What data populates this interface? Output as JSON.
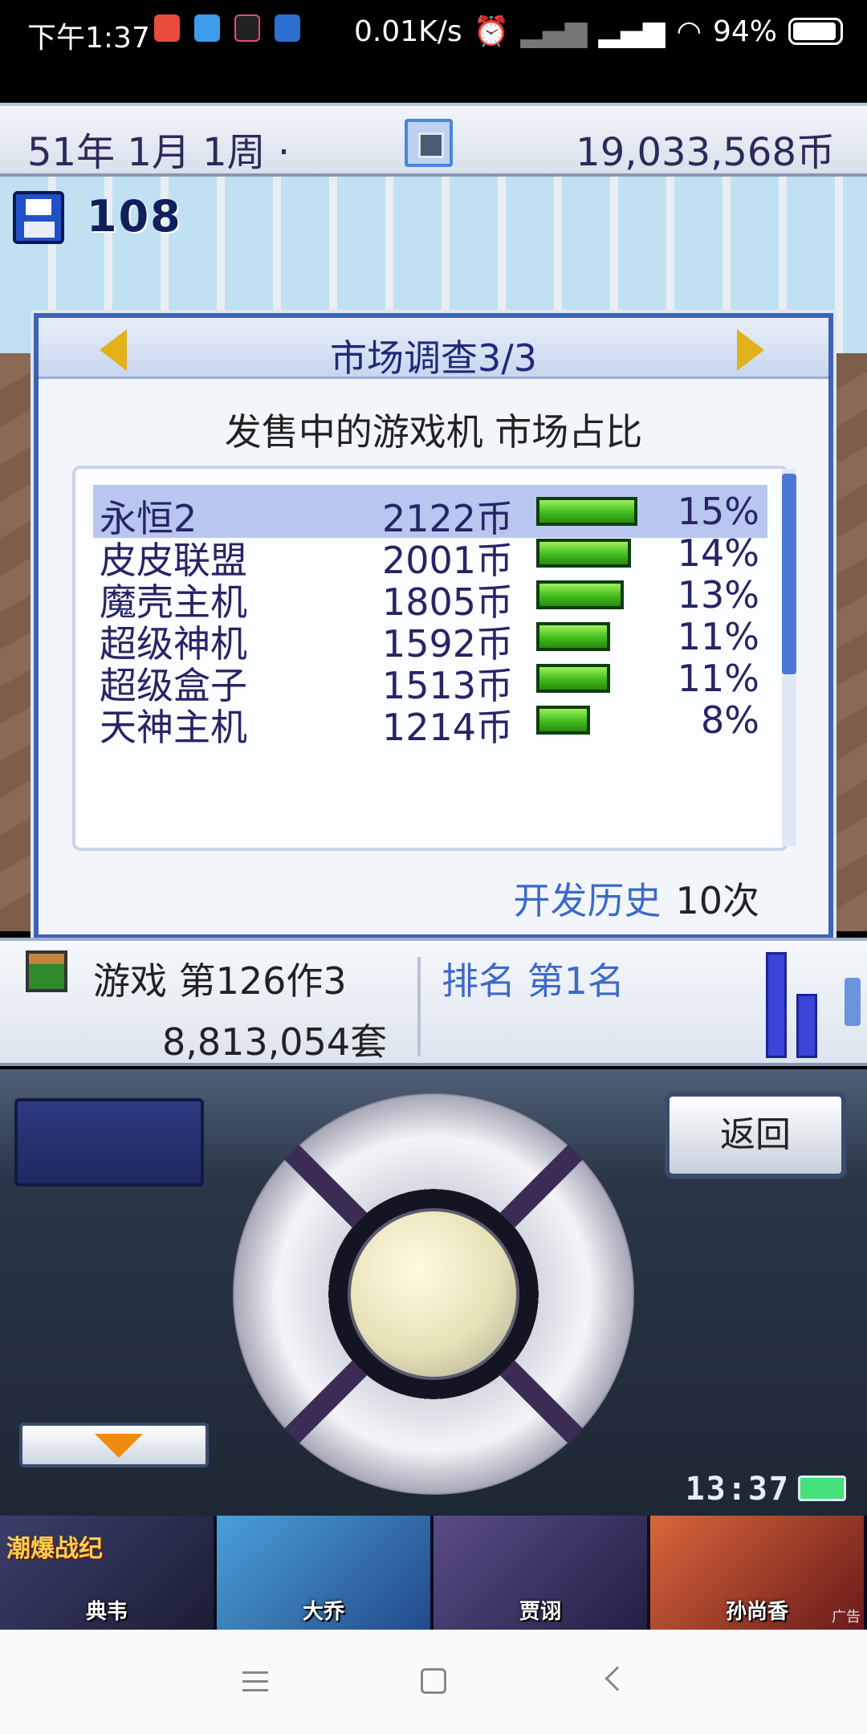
{
  "status_bar": {
    "time": "下午1:37",
    "net_speed": "0.01K/s",
    "battery": "94%",
    "icons": [
      "app-icon",
      "qq-icon",
      "tiktok-icon",
      "app-icon",
      "alarm-icon",
      "signal-icon",
      "hd-signal-icon",
      "wifi-icon",
      "battery-icon"
    ]
  },
  "topbar": {
    "date": "51年 1月 1周 ·",
    "money": "19,033,568币"
  },
  "save": {
    "count": "108"
  },
  "dialog": {
    "title": "市场调查3/3",
    "subtitle": "发售中的游戏机 市场占比",
    "rows": [
      {
        "name": "永恒2",
        "price": "2122币",
        "percent": "15%",
        "share": 15
      },
      {
        "name": "皮皮联盟",
        "price": "2001币",
        "percent": "14%",
        "share": 14
      },
      {
        "name": "魔壳主机",
        "price": "1805币",
        "percent": "13%",
        "share": 13
      },
      {
        "name": "超级神机",
        "price": "1592币",
        "percent": "11%",
        "share": 11
      },
      {
        "name": "超级盒子",
        "price": "1513币",
        "percent": "11%",
        "share": 11
      },
      {
        "name": "天神主机",
        "price": "1214币",
        "percent": "8%",
        "share": 8
      }
    ],
    "history_label": "开发历史",
    "history_value": "10次"
  },
  "info": {
    "title": "游戏 第126作3",
    "sales": "8,813,054套",
    "rank": "排名 第1名"
  },
  "controls": {
    "back_label": "返回",
    "clock": "13:37"
  },
  "ad": {
    "brand": "潮爆战纪",
    "heroes": [
      "典韦",
      "大乔",
      "贾诩",
      "孙尚香"
    ],
    "label": "广告"
  },
  "colors": {
    "dialog_border": "#3d63b3",
    "title_text": "#1e2a78",
    "bar_green": "#3cb81a",
    "accent_blue": "#3d69c9",
    "arrow_yellow": "#e2b21a"
  }
}
